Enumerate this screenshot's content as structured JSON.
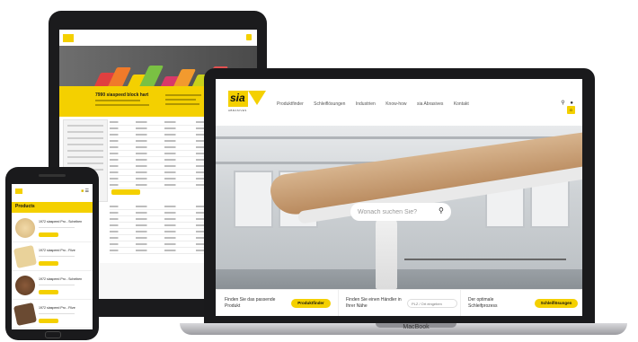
{
  "laptop": {
    "brand_label": "MacBook",
    "logo": {
      "wordmark": "sia",
      "subtitle": "ABRASIVES"
    },
    "nav": [
      "Produktfinder",
      "Schleiflösungen",
      "Industrien",
      "Know-how",
      "sia Abrasives",
      "Kontakt"
    ],
    "icons": [
      "search-icon",
      "user-icon",
      "cart-icon"
    ],
    "cart_count": "0",
    "search": {
      "placeholder": "Wonach suchen Sie?"
    },
    "bottom_bar": [
      {
        "text": "Finden Sie das passende Produkt",
        "button": "Produktfinder"
      },
      {
        "text": "Finden Sie einen Händler in Ihrer Nähe",
        "input_placeholder": "PLZ / Ort eingeben"
      },
      {
        "text": "Der optimale Schleifprozess",
        "button": "Schleiflösungen"
      }
    ]
  },
  "tablet": {
    "hero_title": "7990 siaspeed block hart"
  },
  "phone": {
    "section_title": "Products",
    "items": [
      {
        "name": "1972 siaspeed Pro - Scheiben"
      },
      {
        "name": "1972 siaspeed Pro - Filze"
      },
      {
        "name": "1972 siaspeed Pro - Scheiben"
      },
      {
        "name": "1972 siaspeed Pro - Filze"
      }
    ]
  },
  "colors": {
    "accent": "#f4d000",
    "device_frame": "#1a1a1c"
  }
}
